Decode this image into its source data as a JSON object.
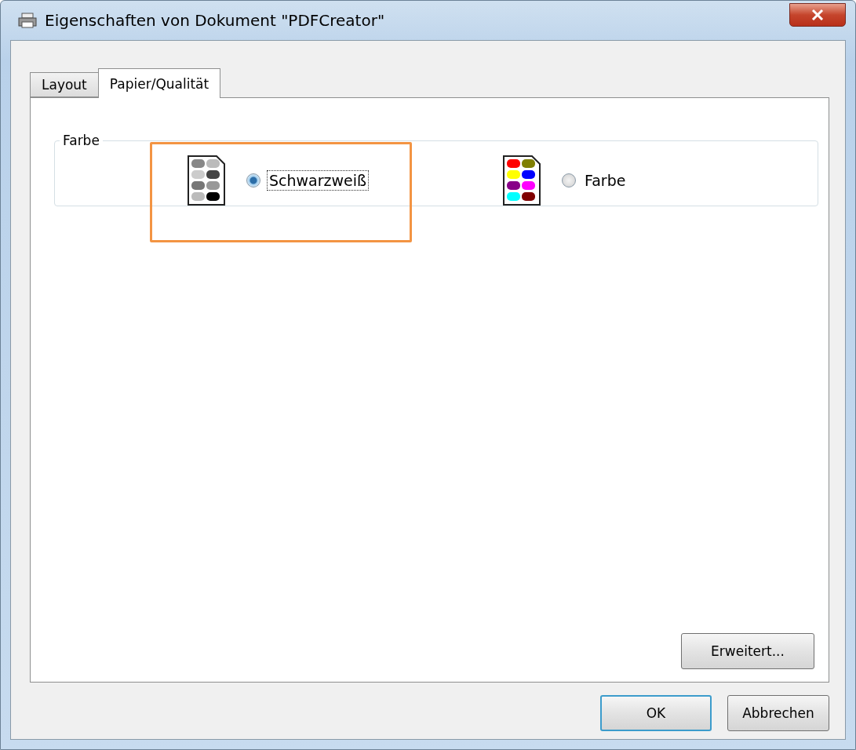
{
  "window": {
    "title": "Eigenschaften von Dokument \"PDFCreator\""
  },
  "tabs": [
    {
      "label": "Layout",
      "selected": false
    },
    {
      "label": "Papier/Qualität",
      "selected": true
    }
  ],
  "color_group": {
    "title": "Farbe",
    "options": [
      {
        "kind": "mono",
        "label": "Schwarzweiß",
        "selected": true,
        "highlighted": true
      },
      {
        "kind": "color",
        "label": "Farbe",
        "selected": false,
        "highlighted": false
      }
    ]
  },
  "advanced_button": "Erweitert...",
  "buttons": [
    {
      "label": "OK",
      "default": true
    },
    {
      "label": "Abbrechen",
      "default": false
    }
  ]
}
